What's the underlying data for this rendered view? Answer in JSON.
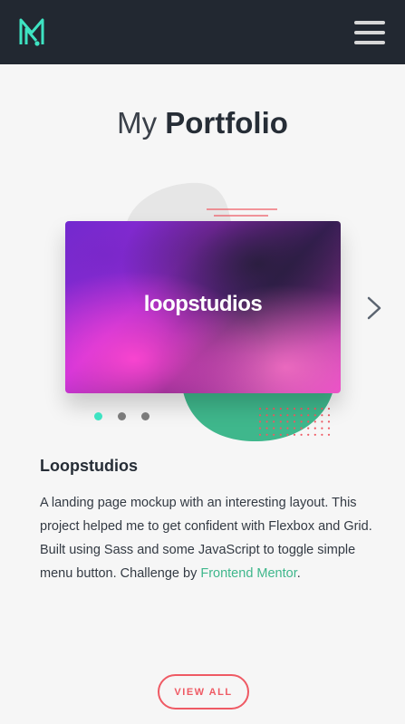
{
  "header": {
    "logo_icon": "monogram-logo-icon",
    "menu_icon": "hamburger-menu-icon"
  },
  "portfolio": {
    "title_light": "My",
    "title_bold": "Portfolio"
  },
  "slider": {
    "card_label": "loopstudios",
    "next_icon": "chevron-right-icon",
    "dots": 3,
    "active_dot": 0
  },
  "project": {
    "name": "Loopstudios",
    "description": "A landing page mockup with an interesting layout. This project helped me to get confident with Flexbox and Grid. Built using Sass and some JavaScript to toggle simple menu button. Challenge by ",
    "link_text": "Frontend Mentor",
    "description_end": "."
  },
  "cta": {
    "view_all_label": "VIEW ALL"
  },
  "colors": {
    "header_bg": "#222831",
    "accent_teal": "#3ee3c2",
    "accent_green": "#3fb78c",
    "accent_red": "#ef5a64"
  }
}
